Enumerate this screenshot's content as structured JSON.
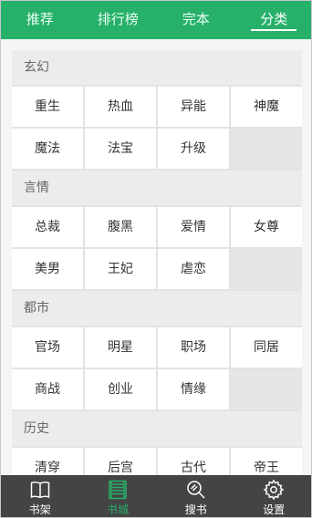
{
  "top_tabs": [
    {
      "label": "推荐",
      "active": false
    },
    {
      "label": "排行榜",
      "active": false
    },
    {
      "label": "完本",
      "active": false
    },
    {
      "label": "分类",
      "active": true
    }
  ],
  "categories": [
    {
      "title": "玄幻",
      "items": [
        "重生",
        "热血",
        "异能",
        "神魔",
        "魔法",
        "法宝",
        "升级"
      ]
    },
    {
      "title": "言情",
      "items": [
        "总裁",
        "腹黑",
        "爱情",
        "女尊",
        "美男",
        "王妃",
        "虐恋"
      ]
    },
    {
      "title": "都市",
      "items": [
        "官场",
        "明星",
        "职场",
        "同居",
        "商战",
        "创业",
        "情缘"
      ]
    },
    {
      "title": "历史",
      "items": [
        "清穿",
        "后宫",
        "古代",
        "帝王"
      ]
    }
  ],
  "bottom_nav": [
    {
      "label": "书架",
      "icon": "book-open-icon",
      "active": false
    },
    {
      "label": "书城",
      "icon": "bookstore-icon",
      "active": true
    },
    {
      "label": "搜书",
      "icon": "search-icon",
      "active": false
    },
    {
      "label": "设置",
      "icon": "gear-icon",
      "active": false
    }
  ],
  "colors": {
    "accent": "#26b06a",
    "nav_background": "#444444",
    "section_background": "#ececec"
  }
}
